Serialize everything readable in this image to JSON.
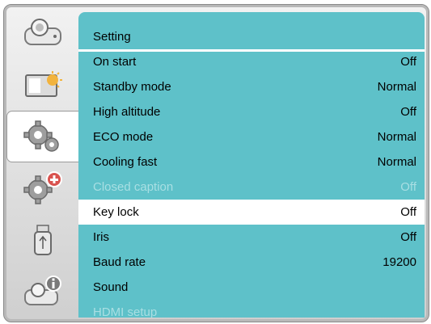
{
  "panel": {
    "title": "Setting"
  },
  "sidebar": {
    "items": [
      {
        "icon": "projector-icon",
        "active": false
      },
      {
        "icon": "picture-brightness-icon",
        "active": false
      },
      {
        "icon": "gear-setting-icon",
        "active": true
      },
      {
        "icon": "gear-plus-icon",
        "active": false
      },
      {
        "icon": "usb-icon",
        "active": false
      },
      {
        "icon": "projector-info-icon",
        "active": false
      }
    ]
  },
  "menu": {
    "rows": [
      {
        "label": "On start",
        "value": "Off",
        "state": "normal"
      },
      {
        "label": "Standby mode",
        "value": "Normal",
        "state": "normal"
      },
      {
        "label": "High altitude",
        "value": "Off",
        "state": "normal"
      },
      {
        "label": "ECO mode",
        "value": "Normal",
        "state": "normal"
      },
      {
        "label": "Cooling fast",
        "value": "Normal",
        "state": "normal"
      },
      {
        "label": "Closed caption",
        "value": "Off",
        "state": "disabled"
      },
      {
        "label": "Key lock",
        "value": "Off",
        "state": "selected"
      },
      {
        "label": "Iris",
        "value": "Off",
        "state": "normal"
      },
      {
        "label": "Baud rate",
        "value": "19200",
        "state": "normal"
      },
      {
        "label": "Sound",
        "value": "",
        "state": "normal"
      },
      {
        "label": "HDMI setup",
        "value": "",
        "state": "disabled"
      }
    ]
  },
  "colors": {
    "panel": "#5ec1c9",
    "selected_row": "#ffffff",
    "disabled_text": "#a9dfe3"
  }
}
